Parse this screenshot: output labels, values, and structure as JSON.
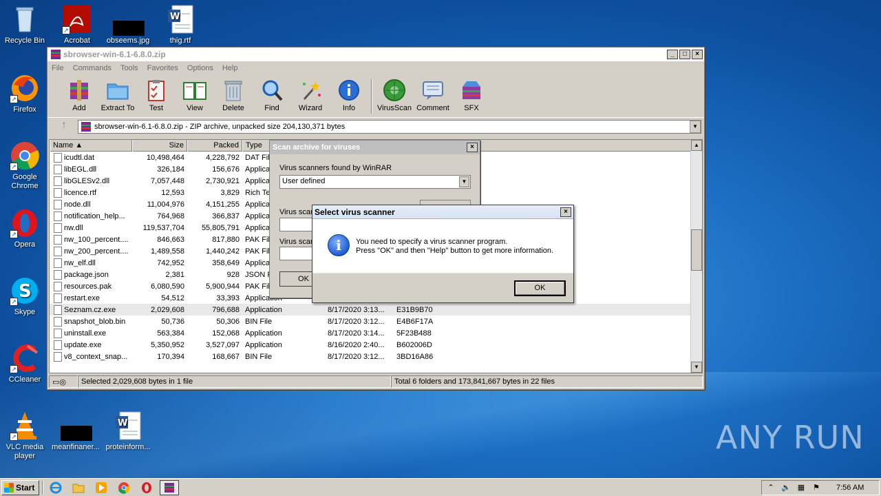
{
  "desktop": {
    "icons": [
      {
        "label": "Recycle Bin",
        "icon": "recycle-bin-icon"
      },
      {
        "label": "Acrobat",
        "icon": "acrobat-icon"
      },
      {
        "label": "obseems.jpg",
        "icon": "image-file-icon"
      },
      {
        "label": "thig.rtf",
        "icon": "word-doc-icon"
      },
      {
        "label": "Firefox",
        "icon": "firefox-icon"
      },
      {
        "label": "Google Chrome",
        "icon": "chrome-icon"
      },
      {
        "label": "Opera",
        "icon": "opera-icon"
      },
      {
        "label": "Skype",
        "icon": "skype-icon"
      },
      {
        "label": "CCleaner",
        "icon": "ccleaner-icon"
      },
      {
        "label": "VLC media player",
        "icon": "vlc-icon"
      },
      {
        "label": "meanfinaner...",
        "icon": "image-file-icon"
      },
      {
        "label": "proteinform...",
        "icon": "word-doc-icon"
      }
    ],
    "watermark": "ANY RUN"
  },
  "winrar": {
    "title": "sbrowser-win-6.1-6.8.0.zip",
    "menu": [
      "File",
      "Commands",
      "Tools",
      "Favorites",
      "Options",
      "Help"
    ],
    "toolbar": [
      {
        "label": "Add",
        "icon": "add-archive-icon"
      },
      {
        "label": "Extract To",
        "icon": "extract-folder-icon"
      },
      {
        "label": "Test",
        "icon": "test-clipboard-icon"
      },
      {
        "label": "View",
        "icon": "view-book-icon"
      },
      {
        "label": "Delete",
        "icon": "trash-icon"
      },
      {
        "label": "Find",
        "icon": "magnifier-icon"
      },
      {
        "label": "Wizard",
        "icon": "wand-icon"
      },
      {
        "label": "Info",
        "icon": "info-icon"
      },
      {
        "label": "VirusScan",
        "icon": "virus-scan-icon"
      },
      {
        "label": "Comment",
        "icon": "comment-icon"
      },
      {
        "label": "SFX",
        "icon": "sfx-box-icon"
      }
    ],
    "address": "sbrowser-win-6.1-6.8.0.zip - ZIP archive, unpacked size 204,130,371 bytes",
    "columns": [
      "Name",
      "Size",
      "Packed",
      "Type",
      "",
      ""
    ],
    "files": [
      {
        "name": "icudtl.dat",
        "size": "10,498,464",
        "packed": "4,228,792",
        "type": "DAT Fil",
        "modified": "",
        "crc": ""
      },
      {
        "name": "libEGL.dll",
        "size": "326,184",
        "packed": "156,676",
        "type": "Applica",
        "modified": "",
        "crc": ""
      },
      {
        "name": "libGLESv2.dll",
        "size": "7,057,448",
        "packed": "2,730,921",
        "type": "Applica",
        "modified": "",
        "crc": ""
      },
      {
        "name": "licence.rtf",
        "size": "12,593",
        "packed": "3,829",
        "type": "Rich Te",
        "modified": "",
        "crc": ""
      },
      {
        "name": "node.dll",
        "size": "11,004,976",
        "packed": "4,151,255",
        "type": "Applica",
        "modified": "",
        "crc": ""
      },
      {
        "name": "notification_help...",
        "size": "764,968",
        "packed": "366,837",
        "type": "Applica",
        "modified": "",
        "crc": ""
      },
      {
        "name": "nw.dll",
        "size": "119,537,704",
        "packed": "55,805,791",
        "type": "Applica",
        "modified": "",
        "crc": ""
      },
      {
        "name": "nw_100_percent....",
        "size": "846,663",
        "packed": "817,880",
        "type": "PAK Fil",
        "modified": "",
        "crc": ""
      },
      {
        "name": "nw_200_percent....",
        "size": "1,489,558",
        "packed": "1,440,242",
        "type": "PAK Fil",
        "modified": "",
        "crc": ""
      },
      {
        "name": "nw_elf.dll",
        "size": "742,952",
        "packed": "358,649",
        "type": "Applica",
        "modified": "",
        "crc": ""
      },
      {
        "name": "package.json",
        "size": "2,381",
        "packed": "928",
        "type": "JSON F",
        "modified": "",
        "crc": ""
      },
      {
        "name": "resources.pak",
        "size": "6,080,590",
        "packed": "5,900,944",
        "type": "PAK Fil",
        "modified": "",
        "crc": ""
      },
      {
        "name": "restart.exe",
        "size": "54,512",
        "packed": "33,393",
        "type": "Application",
        "modified": "",
        "crc": ""
      },
      {
        "name": "Seznam.cz.exe",
        "size": "2,029,608",
        "packed": "796,688",
        "type": "Application",
        "modified": "8/17/2020 3:13...",
        "crc": "E31B9B70"
      },
      {
        "name": "snapshot_blob.bin",
        "size": "50,736",
        "packed": "50,306",
        "type": "BIN File",
        "modified": "8/17/2020 3:12...",
        "crc": "E4B6F17A"
      },
      {
        "name": "uninstall.exe",
        "size": "563,384",
        "packed": "152,068",
        "type": "Application",
        "modified": "8/17/2020 3:14...",
        "crc": "5F23B488"
      },
      {
        "name": "update.exe",
        "size": "5,350,952",
        "packed": "3,527,097",
        "type": "Application",
        "modified": "8/16/2020 2:40...",
        "crc": "B602006D"
      },
      {
        "name": "v8_context_snap...",
        "size": "170,394",
        "packed": "168,667",
        "type": "BIN File",
        "modified": "8/17/2020 3:12...",
        "crc": "3BD16A86"
      }
    ],
    "status_left": "Selected 2,029,608 bytes in 1 file",
    "status_right": "Total 6 folders and 173,841,667 bytes in 22 files"
  },
  "scan_dialog": {
    "title": "Scan archive for viruses",
    "found_label": "Virus scanners found by WinRAR",
    "selected": "User defined",
    "label2": "Virus scan",
    "label3": "Virus scan",
    "ok": "OK"
  },
  "message_dialog": {
    "title": "Select virus scanner",
    "line1": "You need to specify a virus scanner program.",
    "line2": "Press \"OK\" and then \"Help\" button to get more information.",
    "ok": "OK"
  },
  "taskbar": {
    "start": "Start",
    "apps": [
      "ie-icon",
      "explorer-icon",
      "media-player-icon",
      "chrome-icon",
      "opera-icon",
      "winrar-icon"
    ],
    "clock": "7:56 AM"
  }
}
